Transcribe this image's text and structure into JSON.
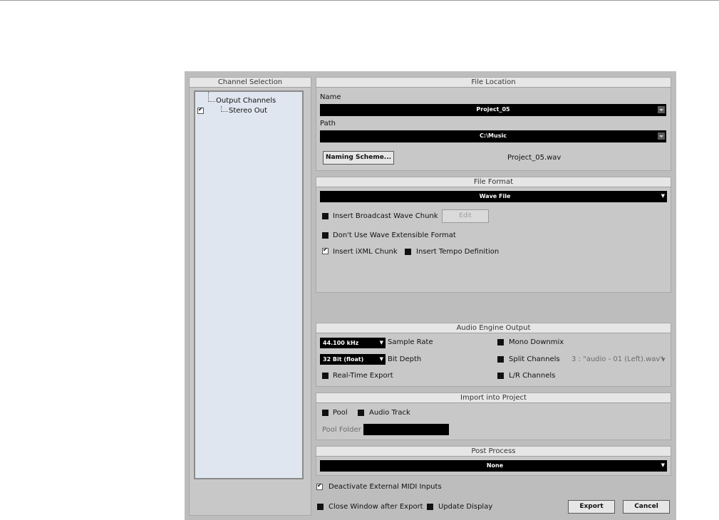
{
  "channel_selection": {
    "title": "Channel Selection",
    "tree": {
      "root": "Output Channels",
      "child": "Stereo Out",
      "child_checked": true
    }
  },
  "file_location": {
    "title": "File Location",
    "name_label": "Name",
    "name_value": "Project_05",
    "path_label": "Path",
    "path_value": "C:\\Music",
    "naming_button": "Naming Scheme...",
    "file_preview": "Project_05.wav"
  },
  "file_format": {
    "title": "File Format",
    "format_value": "Wave File",
    "broadcast_label": "Insert Broadcast Wave Chunk",
    "edit_button": "Edit",
    "extensible_label": "Don't Use Wave Extensible Format",
    "ixml_label": "Insert iXML Chunk",
    "tempo_label": "Insert Tempo Definition"
  },
  "audio_engine": {
    "title": "Audio Engine Output",
    "sample_rate_value": "44.100 kHz",
    "sample_rate_label": "Sample Rate",
    "bit_depth_value": "32 Bit (float)",
    "bit_depth_label": "Bit Depth",
    "realtime_label": "Real-Time Export",
    "mono_label": "Mono Downmix",
    "split_label": "Split Channels",
    "split_value": "3 : \"audio - 01 (Left).wav\"",
    "lr_label": "L/R Channels"
  },
  "import_project": {
    "title": "Import into Project",
    "pool_label": "Pool",
    "audio_track_label": "Audio Track",
    "pool_folder_label": "Pool Folder"
  },
  "post_process": {
    "title": "Post Process",
    "value": "None"
  },
  "footer": {
    "deactivate_midi_label": "Deactivate External MIDI Inputs",
    "close_window_label": "Close Window after Export",
    "update_display_label": "Update Display",
    "export_button": "Export",
    "cancel_button": "Cancel"
  }
}
